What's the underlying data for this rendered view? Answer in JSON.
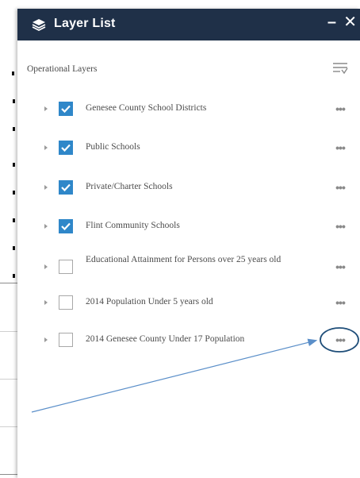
{
  "panel": {
    "title": "Layer List",
    "minimize_label": "–",
    "close_label": "✕",
    "section_label": "Operational Layers"
  },
  "layers": [
    {
      "label": "Genesee County School Districts",
      "checked": true,
      "more_label": "•••"
    },
    {
      "label": "Public Schools",
      "checked": true,
      "more_label": "•••"
    },
    {
      "label": "Private/Charter Schools",
      "checked": true,
      "more_label": "•••"
    },
    {
      "label": "Flint Community Schools",
      "checked": true,
      "more_label": "•••"
    },
    {
      "label": "Educational Attainment for Persons over 25 years old",
      "checked": false,
      "more_label": "•••"
    },
    {
      "label": "2014 Population Under 5 years old",
      "checked": false,
      "more_label": "•••"
    },
    {
      "label": "2014 Genesee County Under 17 Population",
      "checked": false,
      "more_label": "•••"
    }
  ],
  "colors": {
    "header": "#1f3048",
    "checkbox_checked": "#2f87c9",
    "annotation": "#5b8fc9",
    "annotation_circle": "#1f4e79"
  },
  "icons": {
    "header": "layers-icon",
    "filter": "filter-list-icon",
    "expand": "expand-arrow-icon",
    "check": "checkmark-icon",
    "more": "more-options-icon"
  }
}
